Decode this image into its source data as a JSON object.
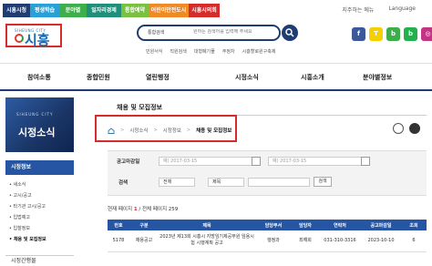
{
  "top_tabs": [
    {
      "label": "시흥시청",
      "color": "#1f3d73"
    },
    {
      "label": "평생학습",
      "color": "#2aa0d8"
    },
    {
      "label": "분야별",
      "color": "#3dae49"
    },
    {
      "label": "일자리경제",
      "color": "#1f8f7a"
    },
    {
      "label": "통합예약",
      "color": "#7ac142"
    },
    {
      "label": "어린이안전도시",
      "color": "#f08a24"
    },
    {
      "label": "시흥시의회",
      "color": "#d62b2b"
    }
  ],
  "top_links": {
    "site_map": "지주하는 메뉴",
    "language": "Language"
  },
  "logo": {
    "city_en": "SIHEUNG CITY",
    "city_ko": "시흥"
  },
  "search": {
    "category": "통합검색",
    "placeholder": "원하는 검색어를 입력해 주세요"
  },
  "keywords": [
    "민원서식",
    "직원검색",
    "대형폐기물",
    "주정차",
    "시흥할로윈구축제"
  ],
  "social": [
    {
      "icon": "facebook-icon",
      "glyph": "f",
      "color": "#3b5998"
    },
    {
      "icon": "kakaotalk-icon",
      "glyph": "T",
      "color": "#f5d000"
    },
    {
      "icon": "band-icon",
      "glyph": "b",
      "color": "#3dae49"
    },
    {
      "icon": "blog-icon",
      "glyph": "b",
      "color": "#22b14c"
    },
    {
      "icon": "instagram-icon",
      "glyph": "◎",
      "color": "#c13584"
    },
    {
      "icon": "youtube-icon",
      "glyph": "▶",
      "color": "#e52d27"
    }
  ],
  "main_nav": [
    "참여소통",
    "종합민원",
    "열린행정",
    "시정소식",
    "시흥소개",
    "분야별정보"
  ],
  "sidebar": {
    "banner_en": "SIHEUNG CITY",
    "banner_title": "시정소식",
    "menu_head": "시정정보",
    "items": [
      "새소식",
      "고시/공고",
      "타기관 고시/공고",
      "입법예고",
      "입찰정보",
      "채용 및 모집정보"
    ],
    "next_menu": "시정간행물"
  },
  "content": {
    "page_title": "채용 및 모집정보",
    "breadcrumb": [
      "시정소식",
      "시정정보",
      "채용 및 모집정보"
    ],
    "filter": {
      "date_label": "공고마감일",
      "date_from": "예) 2017-03-15",
      "date_to": "예) 2017-03-15",
      "search_label": "검색",
      "select_all": "전체",
      "select_field": "제목",
      "search_button": "검색"
    },
    "count": {
      "prefix": "현재 페이지 ",
      "current": "1",
      "rest": " / 전체 페이지 259"
    },
    "table": {
      "headers": [
        "번호",
        "구분",
        "제목",
        "담당부서",
        "담당자",
        "연락처",
        "공고마감일",
        "조회"
      ],
      "rows": [
        [
          "5178",
          "채용공고",
          "2023년 제13회 시흥시 지방임기제공무원 임용시험 시행계획 공고",
          "행정과",
          "최해희",
          "031-310-3316",
          "2023-10-10",
          "6"
        ]
      ]
    }
  }
}
